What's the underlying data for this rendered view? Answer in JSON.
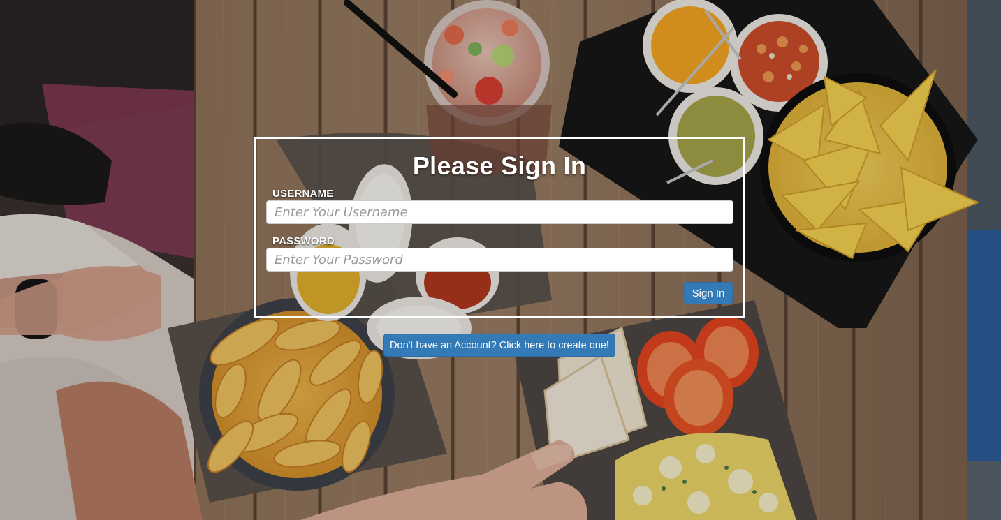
{
  "form": {
    "title": "Please Sign In",
    "username_label": "USERNAME",
    "username_placeholder": "Enter Your Username",
    "password_label": "PASSWORD",
    "password_placeholder": "Enter Your Password",
    "signin_label": "Sign In"
  },
  "create_account": {
    "label": "Don't have an Account? Click here to create one!"
  },
  "colors": {
    "primary_button": "#337ab7",
    "panel_border": "#ffffff"
  }
}
